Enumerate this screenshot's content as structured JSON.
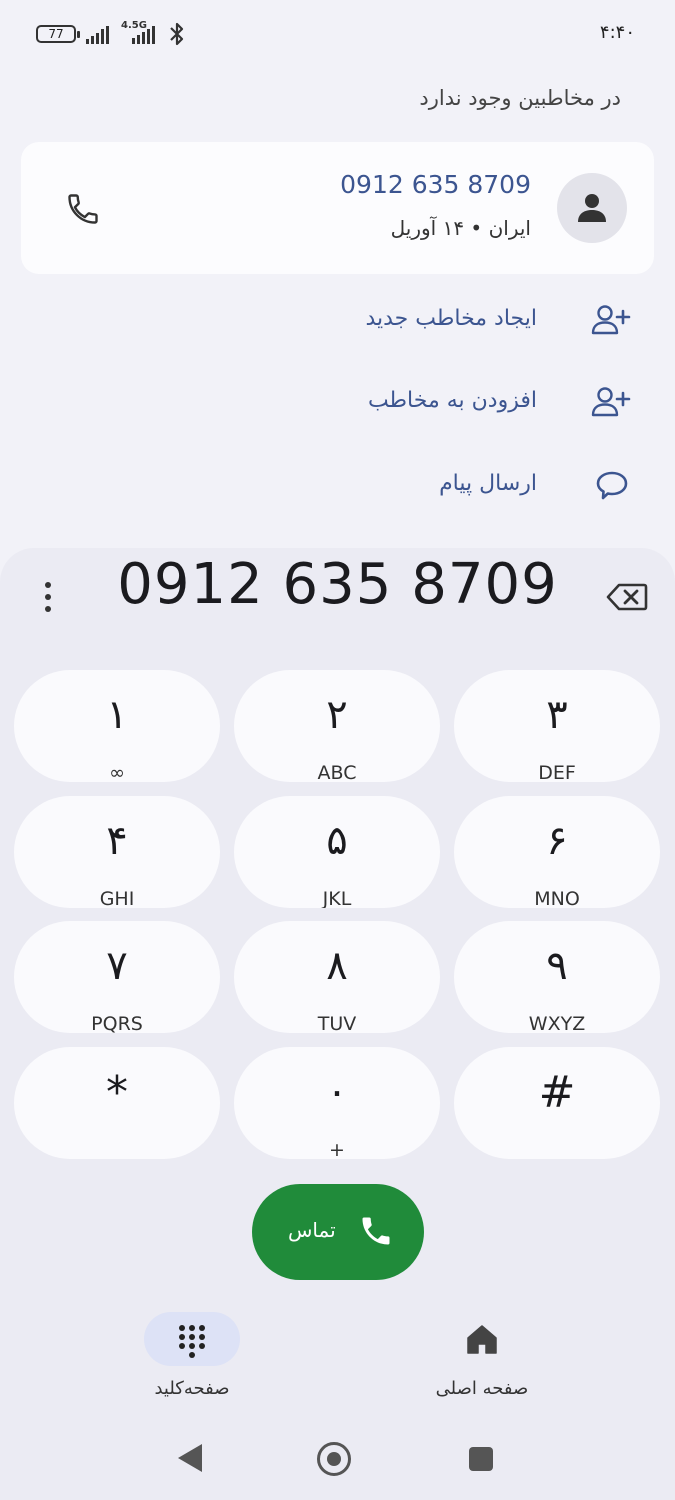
{
  "status_bar": {
    "battery_level": "77",
    "network_label": "4.5G",
    "time": "۴:۴۰"
  },
  "header": {
    "no_contacts_text": "در مخاطبین وجود ندارد"
  },
  "number_card": {
    "number": "0912 635 8709",
    "subtitle": "ایران • ۱۴ آوریل"
  },
  "actions": [
    {
      "label": "ایجاد مخاطب جدید",
      "icon": "add-person-icon"
    },
    {
      "label": "افزودن به مخاطب",
      "icon": "add-person-icon"
    },
    {
      "label": "ارسال پیام",
      "icon": "message-bubble-icon"
    }
  ],
  "dialpad": {
    "display_number": "0912 635 8709",
    "keys": [
      {
        "digit": "۱",
        "letters": "∞"
      },
      {
        "digit": "۲",
        "letters": "ABC"
      },
      {
        "digit": "۳",
        "letters": "DEF"
      },
      {
        "digit": "۴",
        "letters": "GHI"
      },
      {
        "digit": "۵",
        "letters": "JKL"
      },
      {
        "digit": "۶",
        "letters": "MNO"
      },
      {
        "digit": "۷",
        "letters": "PQRS"
      },
      {
        "digit": "۸",
        "letters": "TUV"
      },
      {
        "digit": "۹",
        "letters": "WXYZ"
      },
      {
        "digit": "*",
        "letters": ""
      },
      {
        "digit": "۰",
        "letters": "+"
      },
      {
        "digit": "#",
        "letters": ""
      }
    ]
  },
  "call_button": {
    "label": "تماس",
    "color": "#208b3a"
  },
  "bottom_nav": {
    "keypad_label": "صفحه‌کلید",
    "home_label": "صفحه اصلی"
  },
  "colors": {
    "accent": "#3c5590",
    "nav_pill": "#dde2f6"
  }
}
